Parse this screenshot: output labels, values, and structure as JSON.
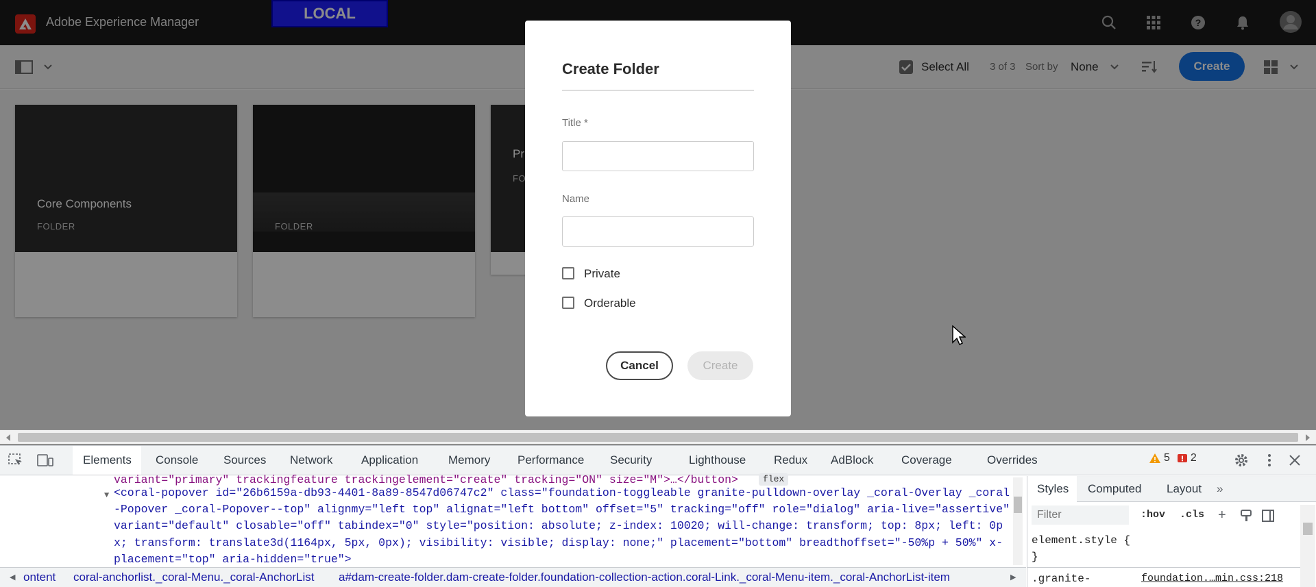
{
  "topbar": {
    "app_title": "Adobe Experience Manager",
    "env_badge": "LOCAL",
    "icons": [
      "search-icon",
      "apps-grid-icon",
      "help-icon",
      "bell-icon",
      "avatar-icon"
    ]
  },
  "actionbar": {
    "select_all": "Select All",
    "count": "3 of 3",
    "sort_by_label": "Sort by",
    "sort_value": "None",
    "create": "Create"
  },
  "cards": [
    {
      "title": "Core Components",
      "type": "FOLDER"
    },
    {
      "title": "",
      "type": "FOLDER"
    },
    {
      "title": "Pr",
      "type": "FO"
    }
  ],
  "dialog": {
    "title": "Create Folder",
    "title_label": "Title *",
    "title_value": "",
    "name_label": "Name",
    "name_value": "",
    "private_label": "Private",
    "orderable_label": "Orderable",
    "cancel": "Cancel",
    "create": "Create",
    "private_checked": false,
    "orderable_checked": false
  },
  "devtools": {
    "tabs": [
      "Elements",
      "Console",
      "Sources",
      "Network",
      "Application",
      "Memory",
      "Performance",
      "Security",
      "Lighthouse",
      "Redux",
      "AdBlock",
      "Coverage",
      "Overrides"
    ],
    "active_tab": "Elements",
    "warnings": "5",
    "errors": "2",
    "html_lines": [
      "variant=\"primary\" trackingfeature trackingelement=\"create\" tracking=\"ON\" size=\"M\">…</button>",
      "<coral-popover id=\"26b6159a-db93-4401-8a89-8547d06747c2\" class=\"foundation-toggleable granite-pulldown-overlay _coral-Overlay _coral",
      "-Popover _coral-Popover--top\" alignmy=\"left top\" alignat=\"left bottom\" offset=\"5\" tracking=\"off\" role=\"dialog\" aria-live=\"assertive\"",
      "variant=\"default\" closable=\"off\" tabindex=\"0\" style=\"position: absolute; z-index: 10020; will-change: transform; top: 8px; left: 0p",
      "x; transform: translate3d(1164px, 5px, 0px); visibility: visible; display: none;\" placement=\"bottom\" breadthoffset=\"-50%p + 50%\" x-",
      "placement=\"top\" aria-hidden=\"true\">"
    ],
    "flex_badge": "flex",
    "styles_tabs": [
      "Styles",
      "Computed",
      "Layout"
    ],
    "filter_placeholder": "Filter",
    "hov": ":hov",
    "cls": ".cls",
    "element_style": "element.style {",
    "close_brace": "}",
    "granite_rule": ".granite-",
    "source_link": "foundation.…min.css:218",
    "breadcrumbs": [
      "ontent",
      "coral-anchorlist._coral-Menu._coral-AnchorList",
      "a#dam-create-folder.dam-create-folder.foundation-collection-action.coral-Link._coral-Menu-item._coral-AnchorList-item"
    ]
  },
  "colors": {
    "accent": "#1473e6",
    "adobe_red": "#e1251b",
    "env_badge": "#1f1fff"
  }
}
